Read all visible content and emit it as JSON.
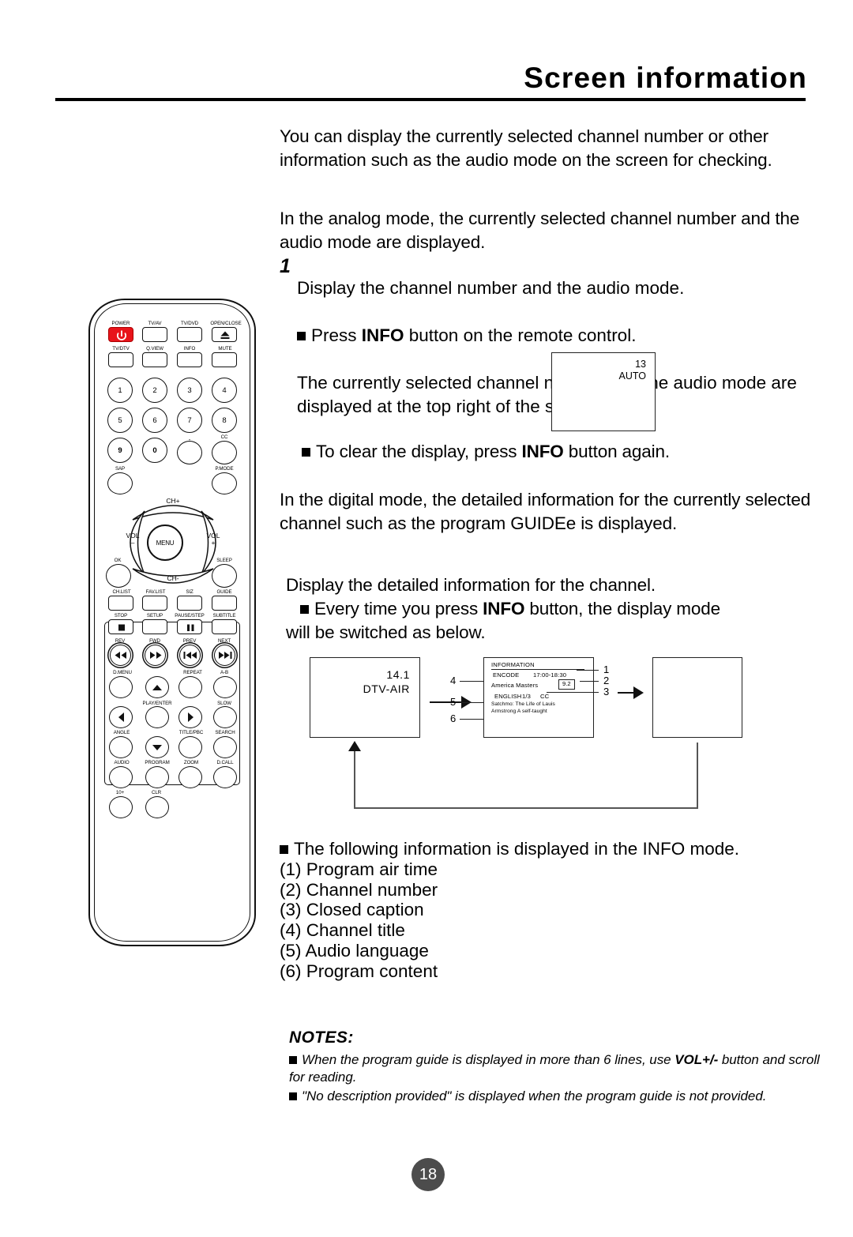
{
  "header": {
    "title": "Screen information"
  },
  "body": {
    "intro": "You can display the currently selected channel number or other information such as the audio mode on the screen for checking.",
    "analog": "In the analog mode, the currently selected channel number and the audio mode are displayed.",
    "step_number": "1",
    "step_title": "Display the channel number and the audio mode.",
    "step_bullet": "Press INFO button on the remote control.",
    "step_body": "The currently selected channel number and the audio mode are displayed at the top right of the screen.",
    "clear_note": "To clear the display, press INFO button again.",
    "digital": "In the digital mode, the detailed information for the currently selected channel such as the program GUIDEe is displayed.",
    "display_title": "Display the detailed information for the channel.",
    "display_bullet": "Every time you press INFO button, the display mode",
    "display_bullet_cont": "will be switched as below.",
    "info_list_heading": "The following information is displayed in the INFO mode.",
    "info_list": [
      "(1) Program air time",
      "(2) Channel number",
      "(3) Closed caption",
      "(4) Channel title",
      "(5) Audio language",
      "(6) Program content"
    ]
  },
  "analog_screen": {
    "channel": "13",
    "audio_mode": "AUTO"
  },
  "flow": {
    "box1": {
      "channel": "14.1",
      "source": "DTV-AIR"
    },
    "box2": {
      "title": "INFORMATION",
      "encode_label": "ENCODE",
      "air_time": "17:00-18:30",
      "program_title": "America Masters",
      "channel_number": "9.2",
      "language": "ENGLISH",
      "ratio": "1/3",
      "cc": "CC",
      "description": "Satchmo: The Life of Lauis\n   Armstrong A self-taught"
    },
    "callouts_right": [
      "1",
      "2",
      "3"
    ],
    "callouts_left": [
      "4",
      "5",
      "6"
    ]
  },
  "notes": {
    "heading": "NOTES:",
    "items": [
      "When the program guide is displayed in more than 6 lines, use VOL+/- button and scroll for reading.",
      "\"No description provided\" is displayed when the program guide is not provided."
    ],
    "item1_a": "When the program guide is displayed in more than 6 lines, use ",
    "item1_b": "VOL+/-",
    "item1_c": " button and scroll for reading.",
    "item2": "\"No description provided\" is displayed when the program guide is not provided."
  },
  "page_number": "18",
  "remote": {
    "colors": {
      "power_red": "#e8131a",
      "outline": "#111111"
    },
    "row_top1": [
      "POWER",
      "TV/AV",
      "TV/DVD",
      "OPEN/CLOSE"
    ],
    "row_top2": [
      "TV/DTV",
      "Q.VIEW",
      "INFO",
      "MUTE"
    ],
    "numbers_r1": [
      "1",
      "2",
      "3",
      "4"
    ],
    "numbers_r2": [
      "5",
      "6",
      "7",
      "8"
    ],
    "numbers_r3": [
      "9",
      "0",
      "-",
      "CC"
    ],
    "row_sap": [
      "SAP",
      "P.MODE"
    ],
    "dpad": {
      "up": "CH+",
      "down": "CH-",
      "left": "VOL\n–",
      "right": "VOL\n+",
      "center": "MENU"
    },
    "row_ok": [
      "OK",
      "SLEEP"
    ],
    "row_list": [
      "CH.LIST",
      "FAV.LIST",
      "SIZ",
      "GUIDE"
    ],
    "row_stop": [
      "STOP",
      "SETUP",
      "PAUSE/STEP",
      "SUBTITLE"
    ],
    "row_trans": [
      "REV",
      "FWD",
      "PREV",
      "NEXT"
    ],
    "row_dmenu": [
      "D.MENU",
      "REPEAT",
      "A-B"
    ],
    "row_play": [
      "PLAY/ENTER",
      "SLOW"
    ],
    "row_angle": [
      "ANGLE",
      "TITLE/PBC",
      "SEARCH"
    ],
    "row_audio": [
      "AUDIO",
      "PROGRAM",
      "ZOOM",
      "D.CALL"
    ],
    "row_last": [
      "10+",
      "CLR"
    ]
  }
}
